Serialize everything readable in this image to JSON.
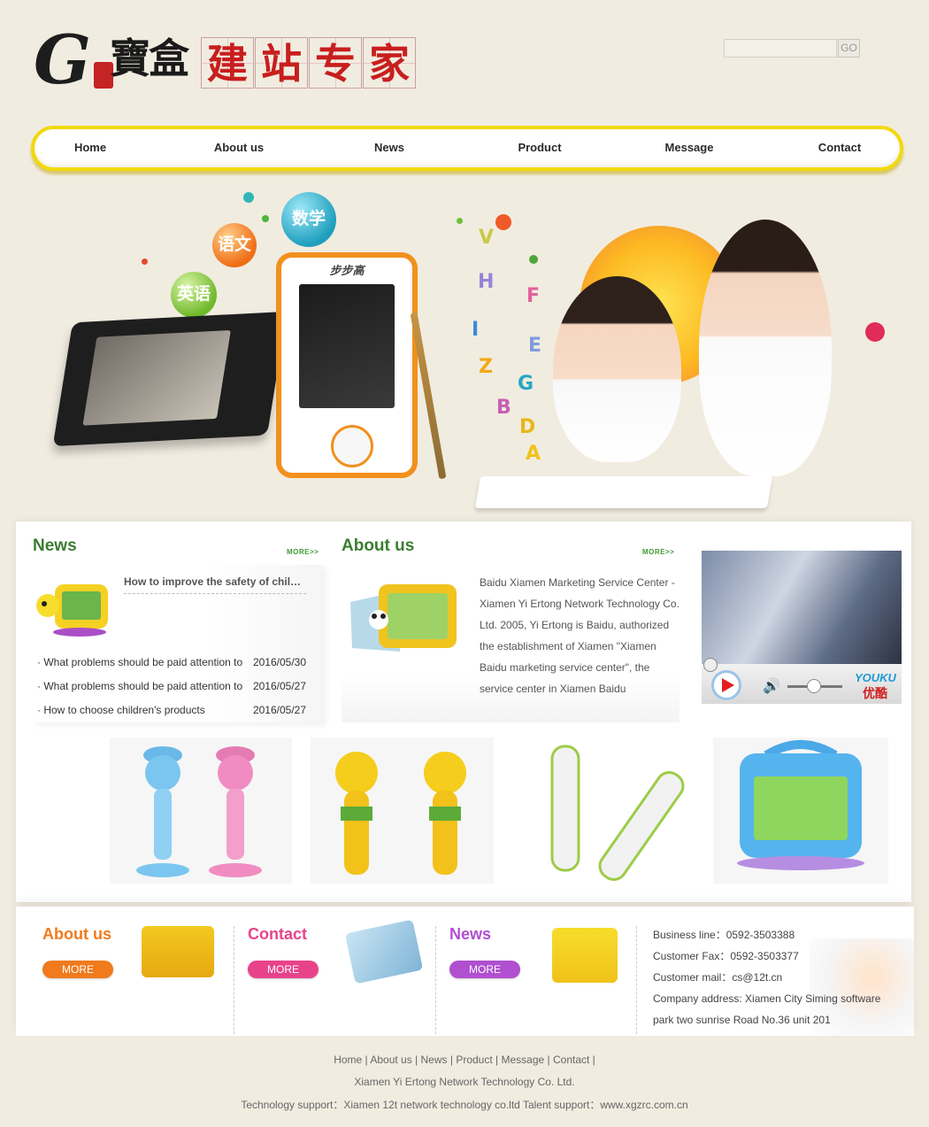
{
  "header": {
    "logo_letter": "G",
    "logo_brand": "寶盒",
    "logo_slogan": [
      "建",
      "站",
      "专",
      "家"
    ],
    "search_placeholder": "",
    "search_button": "GO"
  },
  "nav": [
    "Home",
    "About us",
    "News",
    "Product",
    "Message",
    "Contact"
  ],
  "banner": {
    "balls": [
      "数学",
      "语文",
      "英语"
    ],
    "device_brand": "步步高",
    "letters": [
      "V",
      "H",
      "F",
      "I",
      "E",
      "Z",
      "G",
      "B",
      "D",
      "A"
    ]
  },
  "news": {
    "title": "News",
    "more": "MORE>>",
    "lead": "How to improve the safety of children",
    "items": [
      {
        "title": "What problems should be paid attention to",
        "date": "2016/05/30"
      },
      {
        "title": "What problems should be paid attention to",
        "date": "2016/05/27"
      },
      {
        "title": "How to choose children's products",
        "date": "2016/05/27"
      }
    ]
  },
  "about": {
    "title": "About us",
    "more": "MORE>>",
    "text": "Baidu Xiamen Marketing Service Center - Xiamen Yi Ertong Network Technology Co. Ltd. 2005, Yi Ertong is Baidu, authorized the establishment of Xiamen \"Xiamen Baidu marketing service center\", the service center in Xiamen Baidu"
  },
  "video": {
    "brand_en": "YOUKU",
    "brand_cn": "优酷",
    "progress": 0,
    "volume": 0.45
  },
  "bottom": {
    "about": {
      "title": "About us",
      "more": "MORE",
      "color": "#f07a1c"
    },
    "contact": {
      "title": "Contact",
      "more": "MORE",
      "color": "#e8438a"
    },
    "news": {
      "title": "News",
      "more": "MORE",
      "color": "#b04fd0"
    },
    "info": [
      "Business line：0592-3503388",
      "Customer Fax：0592-3503377",
      "Customer mail：cs@12t.cn",
      "Company address: Xiamen City Siming software",
      "park two sunrise Road No.36 unit 201"
    ]
  },
  "footer": {
    "links": [
      "Home",
      "About us",
      "News",
      "Product",
      "Message",
      "Contact"
    ],
    "company": "Xiamen Yi Ertong Network Technology Co. Ltd.",
    "support": "Technology support：Xiamen 12t network technology co.ltd Talent support：www.xgzrc.com.cn"
  },
  "colors": {
    "nav_border": "#f2d90b",
    "section_title_green": "#3c7d30",
    "bottom_about": "#f07a1c",
    "bottom_contact": "#e8438a",
    "bottom_news": "#b04fd0",
    "page_bg": "#f1ece0"
  }
}
